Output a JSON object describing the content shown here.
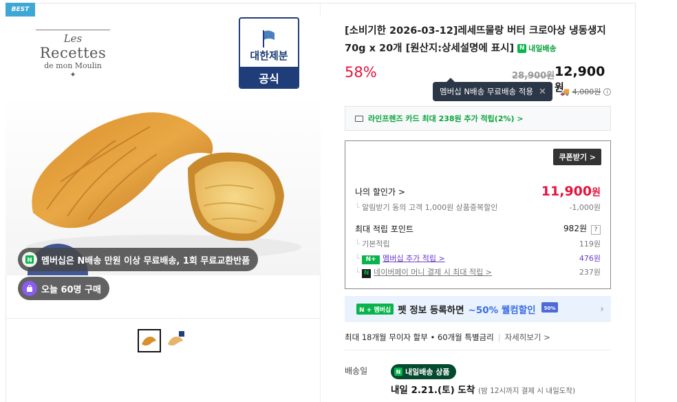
{
  "badge": {
    "best": "BEST"
  },
  "brand": {
    "les": "Les",
    "name": "Recettes",
    "sub": "de mon Moulin"
  },
  "official": {
    "name": "대한제분",
    "label": "공식"
  },
  "overlay": {
    "membership": "멤버십은 N배송 만원 이상 무료배송, 1회 무료교환반품",
    "buyers": "오늘 60명 구매"
  },
  "product": {
    "title": "[소비기한 2026-03-12]레세뜨물랑 버터 크로아상 냉동생지 70g x 20개 [원산지:상세설명에 표시]",
    "tag": "내일배송"
  },
  "pricing": {
    "discount": "58%",
    "original": "28,900원",
    "price": "12,900",
    "won": "원",
    "tooltip": "멤버십 N배송 무료배송 적용",
    "member_shipping_strike": "4,000원"
  },
  "card_benefit": "라인프렌즈 카드 최대 238원 추가 적립(2%) >",
  "coupon": {
    "button": "쿠폰받기 >",
    "my_price_label": "나의 할인가 >",
    "my_price": "11,900",
    "my_price_won": "원",
    "alarm_label": "알림받기 동의 고객 1,000원 상품중복할인",
    "alarm_value": "-1,000원",
    "points_label": "최대 적립 포인트",
    "points_value": "982원",
    "points_q": "?",
    "basic_label": "기본적립",
    "basic_value": "119원",
    "member_label": "멤버십 추가 적립 >",
    "member_value": "476원",
    "npay_label": "네이버페이 머니 결제 시 최대 적립 >",
    "npay_value": "237원"
  },
  "pet_banner": {
    "chip": "N + 멤버십",
    "text": "펫 정보 등록하면",
    "highlight": "~50% 웰컴할인"
  },
  "installment": {
    "text": "최대 18개월 무이자 할부 • 60개월 특별금리",
    "more": "자세히보기 >"
  },
  "shipping": {
    "label": "배송일",
    "badge": "내일배송 상품",
    "date": "내일 2.21.(토) 도착",
    "note": "(밤 12시까지 결제 시 내일도착)"
  },
  "colors": {
    "accent_red": "#e4133d",
    "naver_green": "#09b44c",
    "navy": "#1f3d79"
  }
}
